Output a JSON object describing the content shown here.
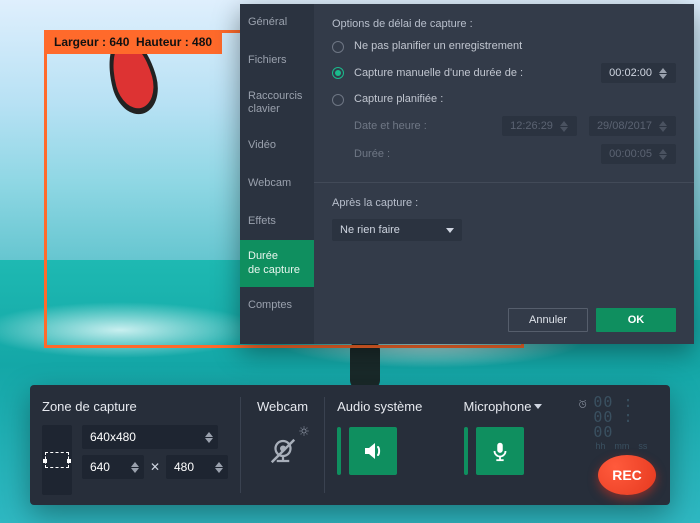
{
  "capture_overlay": {
    "width_label": "Largeur : 640",
    "height_label": "Hauteur : 480"
  },
  "settings": {
    "tabs": {
      "general": "Général",
      "files": "Fichiers",
      "shortcuts": "Raccourcis clavier",
      "video": "Vidéo",
      "webcam": "Webcam",
      "effects": "Effets",
      "duration": "Durée\nde capture",
      "accounts": "Comptes"
    },
    "section_title": "Options de délai de capture :",
    "options": {
      "none": "Ne pas planifier un enregistrement",
      "manual": "Capture manuelle d'une durée de :",
      "scheduled": "Capture planifiée :"
    },
    "manual_duration": "00:02:00",
    "scheduled": {
      "datetime_label": "Date et heure :",
      "time": "12:26:29",
      "date": "29/08/2017",
      "duration_label": "Durée :",
      "duration": "00:00:05"
    },
    "after_label": "Après la capture :",
    "after_value": "Ne rien faire",
    "btn_cancel": "Annuler",
    "btn_ok": "OK"
  },
  "toolbar": {
    "zone_title": "Zone de capture",
    "preset": "640x480",
    "width": "640",
    "height": "480",
    "webcam_title": "Webcam",
    "audio_title": "Audio système",
    "mic_title": "Microphone",
    "timer": "00 : 00 : 00",
    "timer_units": {
      "h": "hh",
      "m": "mm",
      "s": "ss"
    },
    "rec": "REC"
  }
}
